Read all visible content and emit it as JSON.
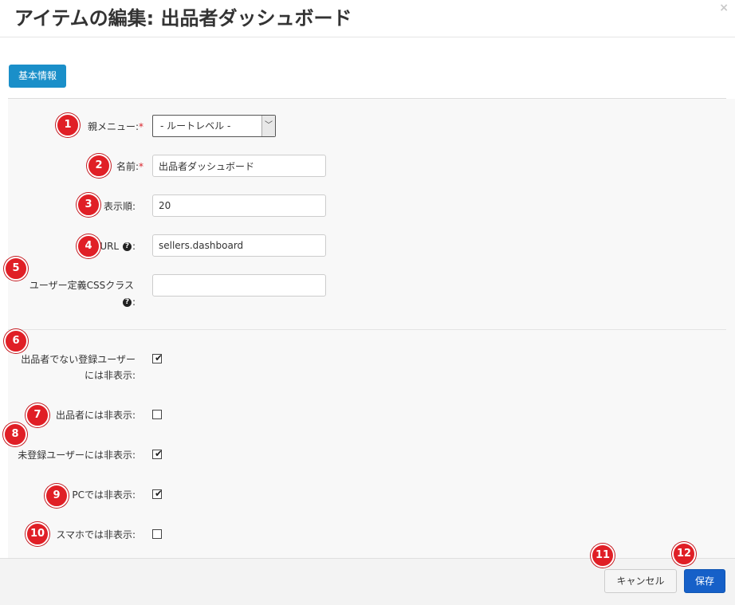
{
  "dialog": {
    "title": "アイテムの編集: 出品者ダッシュボード",
    "close_icon": "×"
  },
  "tabs": [
    {
      "label": "基本情報",
      "active": true
    }
  ],
  "form": {
    "parent_menu": {
      "label": "親メニュー:",
      "required": "*",
      "value": "- ルートレベル -"
    },
    "name": {
      "label": "名前:",
      "required": "*",
      "value": "出品者ダッシュボード"
    },
    "display_order": {
      "label": "表示順:",
      "value": "20"
    },
    "url": {
      "label_prefix": "URL",
      "help_icon": "?",
      "label_suffix": ":",
      "value": "sellers.dashboard"
    },
    "css_class": {
      "label": "ユーザー定義CSSクラス",
      "help_icon": "?",
      "label_suffix": ":",
      "value": ""
    },
    "hide_non_seller": {
      "label_line1": "出品者でない登録ユーザー",
      "label_line2": "には非表示:",
      "checked": true,
      "mark": "✔"
    },
    "hide_seller": {
      "label": "出品者には非表示:",
      "checked": false
    },
    "hide_guest": {
      "label": "未登録ユーザーには非表示:",
      "checked": true,
      "mark": "✔"
    },
    "hide_pc": {
      "label": "PCでは非表示:",
      "checked": true,
      "mark": "✔"
    },
    "hide_mobile": {
      "label": "スマホでは非表示:",
      "checked": false
    }
  },
  "footer": {
    "cancel_label": "キャンセル",
    "save_label": "保存"
  },
  "annotations": [
    "1",
    "2",
    "3",
    "4",
    "5",
    "6",
    "7",
    "8",
    "9",
    "10",
    "11",
    "12"
  ],
  "colors": {
    "tab_active": "#1a8fc9",
    "save_button": "#1660c8",
    "required_mark": "#d9242b",
    "annotation_badge": "#e01f26"
  }
}
